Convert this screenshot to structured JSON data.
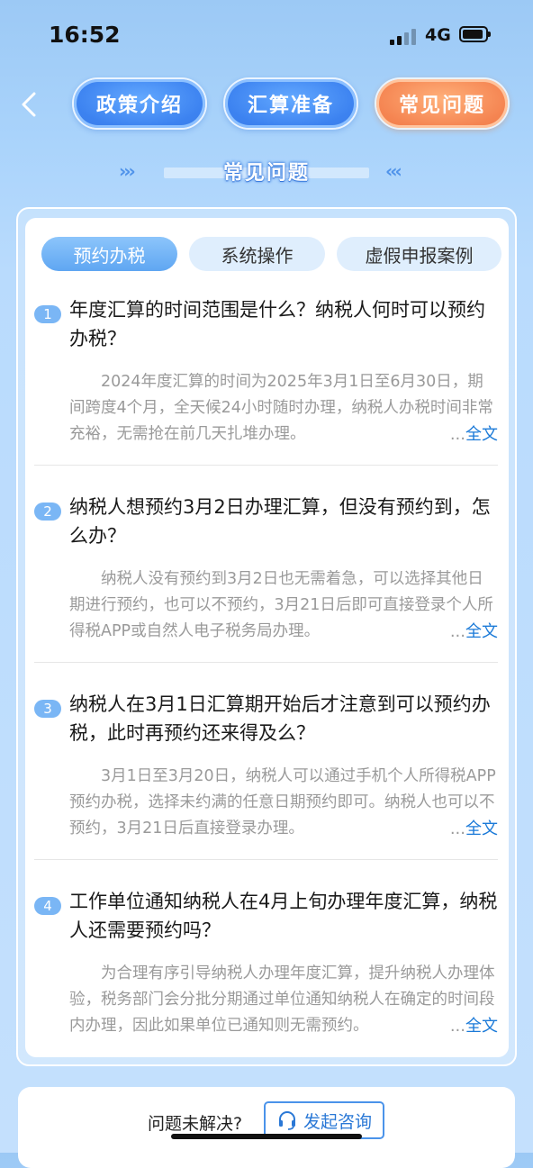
{
  "status": {
    "time": "16:52",
    "network": "4G"
  },
  "topnav": [
    {
      "label": "政策介绍",
      "active": false
    },
    {
      "label": "汇算准备",
      "active": false
    },
    {
      "label": "常见问题",
      "active": true
    }
  ],
  "section_title": "常见问题",
  "tabs": [
    {
      "label": "预约办税",
      "active": true
    },
    {
      "label": "系统操作",
      "active": false
    },
    {
      "label": "虚假申报案例",
      "active": false
    }
  ],
  "questions": [
    {
      "num": "1",
      "title": "年度汇算的时间范围是什么？纳税人何时可以预约办税？",
      "answer": "2024年度汇算的时间为2025年3月1日至6月30日，期间跨度4个月，全天候24小时随时办理，纳税人办税时间非常充裕，无需抢在前几天扎堆办理。"
    },
    {
      "num": "2",
      "title": "纳税人想预约3月2日办理汇算，但没有预约到，怎么办？",
      "answer": "纳税人没有预约到3月2日也无需着急，可以选择其他日期进行预约，也可以不预约，3月21日后即可直接登录个人所得税APP或自然人电子税务局办理。"
    },
    {
      "num": "3",
      "title": "纳税人在3月1日汇算期开始后才注意到可以预约办税，此时再预约还来得及么？",
      "answer": "3月1日至3月20日，纳税人可以通过手机个人所得税APP预约办税，选择未约满的任意日期预约即可。纳税人也可以不预约，3月21日后直接登录办理。"
    },
    {
      "num": "4",
      "title": "工作单位通知纳税人在4月上旬办理年度汇算，纳税人还需要预约吗？",
      "answer": "为合理有序引导纳税人办理年度汇算，提升纳税人办理体验，税务部门会分批分期通过单位通知纳税人在确定的时间段内办理，因此如果单位已通知则无需预约。"
    }
  ],
  "more": {
    "ellipsis": "...",
    "label": "全文"
  },
  "bottom": {
    "prompt": "问题未解决?",
    "consult_label": "发起咨询"
  }
}
